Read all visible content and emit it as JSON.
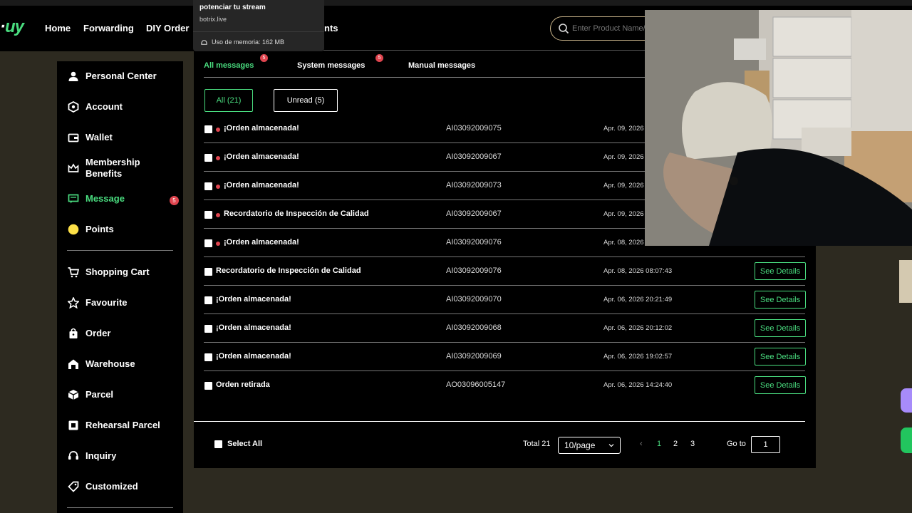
{
  "header": {
    "logo_tail": "uy",
    "nav": [
      "Home",
      "Forwarding",
      "DIY Order"
    ],
    "nav_partial": "nts",
    "search_placeholder": "Enter Product Name/"
  },
  "tooltip": {
    "line1": "potenciar tu stream",
    "line2": "botrix.live",
    "memory": "Uso de memoria: 162 MB"
  },
  "sidebar": {
    "items": [
      {
        "label": "Personal Center",
        "icon": "user-icon"
      },
      {
        "label": "Account",
        "icon": "account-icon"
      },
      {
        "label": "Wallet",
        "icon": "wallet-icon"
      },
      {
        "label": "Membership Benefits",
        "icon": "crown-icon"
      },
      {
        "label": "Message",
        "icon": "message-icon",
        "badge": "5",
        "active": true
      },
      {
        "label": "Points",
        "icon": "points-icon"
      },
      {
        "label": "Shopping Cart",
        "icon": "cart-icon"
      },
      {
        "label": "Favourite",
        "icon": "star-icon"
      },
      {
        "label": "Order",
        "icon": "bag-icon"
      },
      {
        "label": "Warehouse",
        "icon": "warehouse-icon"
      },
      {
        "label": "Parcel",
        "icon": "box-icon"
      },
      {
        "label": "Rehearsal Parcel",
        "icon": "rehearsal-icon"
      },
      {
        "label": "Inquiry",
        "icon": "headset-icon"
      },
      {
        "label": "Customized",
        "icon": "tag-icon"
      }
    ]
  },
  "tabs": [
    {
      "label": "All messages",
      "badge": "5",
      "active": true
    },
    {
      "label": "System messages",
      "badge": "5"
    },
    {
      "label": "Manual messages"
    }
  ],
  "filters": {
    "all": "All (21)",
    "unread": "Unread (5)"
  },
  "messages": [
    {
      "title": "¡Orden almacenada!",
      "code": "AI03092009075",
      "date": "Apr. 09, 2026",
      "unread": true
    },
    {
      "title": "¡Orden almacenada!",
      "code": "AI03092009067",
      "date": "Apr. 09, 2026",
      "unread": true
    },
    {
      "title": "¡Orden almacenada!",
      "code": "AI03092009073",
      "date": "Apr. 09, 2026",
      "unread": true
    },
    {
      "title": "Recordatorio de Inspección de Calidad",
      "code": "AI03092009067",
      "date": "Apr. 09, 2026",
      "unread": true
    },
    {
      "title": "¡Orden almacenada!",
      "code": "AI03092009076",
      "date": "Apr. 08, 2026",
      "unread": true
    },
    {
      "title": "Recordatorio de Inspección de Calidad",
      "code": "AI03092009076",
      "date": "Apr. 08, 2026 08:07:43",
      "unread": false,
      "button": "See Details"
    },
    {
      "title": "¡Orden almacenada!",
      "code": "AI03092009070",
      "date": "Apr. 06, 2026 20:21:49",
      "unread": false,
      "button": "See Details"
    },
    {
      "title": "¡Orden almacenada!",
      "code": "AI03092009068",
      "date": "Apr. 06, 2026 20:12:02",
      "unread": false,
      "button": "See Details"
    },
    {
      "title": "¡Orden almacenada!",
      "code": "AI03092009069",
      "date": "Apr. 06, 2026 19:02:57",
      "unread": false,
      "button": "See Details"
    },
    {
      "title": "Orden retirada",
      "code": "AO03096005147",
      "date": "Apr. 06, 2026 14:24:40",
      "unread": false,
      "button": "See Details"
    }
  ],
  "footer": {
    "select_all": "Select All",
    "total": "Total 21",
    "per_page": "10/page",
    "prev": "‹",
    "pages": [
      "1",
      "2",
      "3"
    ],
    "current_page": "1",
    "goto_label": "Go to",
    "goto_value": "1"
  },
  "colors": {
    "accent": "#4ade80",
    "badge": "#e0454f",
    "background": "#000000"
  }
}
